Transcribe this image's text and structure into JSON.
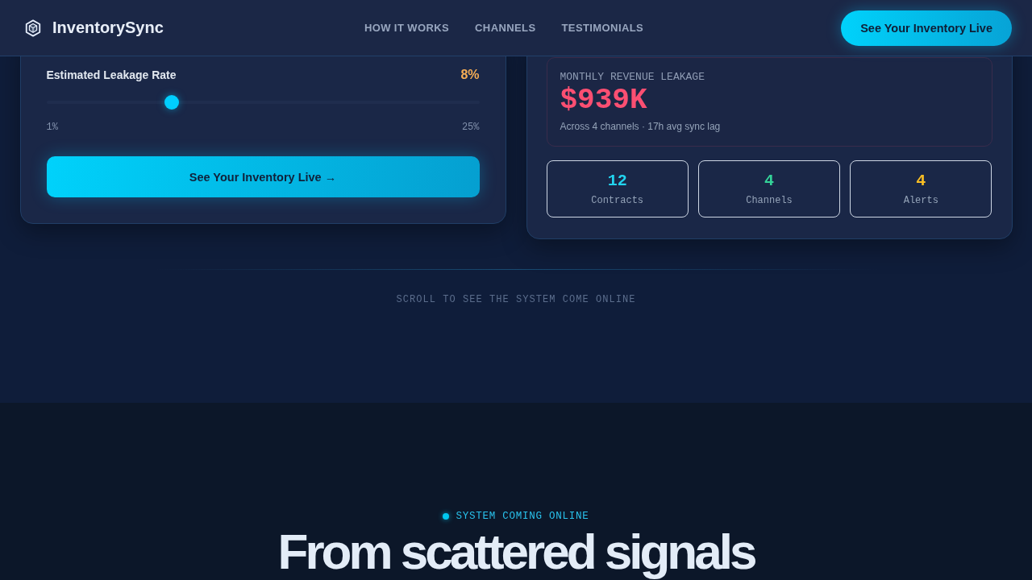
{
  "nav": {
    "brand": "InventorySync",
    "links": [
      "HOW IT WORKS",
      "CHANNELS",
      "TESTIMONIALS"
    ],
    "cta": "See Your Inventory Live"
  },
  "calculator": {
    "slider": {
      "label": "Estimated Leakage Rate",
      "reading": "8%",
      "level": 0.29,
      "min_label": "1%",
      "max_label": "25%"
    },
    "button": "See Your Inventory Live →"
  },
  "results": {
    "leakage": {
      "label": "MONTHLY REVENUE LEAKAGE",
      "value": "$939K",
      "note": "Across 4 channels · 17h avg sync lag"
    },
    "stats": [
      {
        "value": "12",
        "label": "Contracts",
        "color": "#22d3ee"
      },
      {
        "value": "4",
        "label": "Channels",
        "color": "#34d399"
      },
      {
        "value": "4",
        "label": "Alerts",
        "color": "#fbbf24"
      }
    ]
  },
  "scroll_hint": "SCROLL TO SEE THE SYSTEM COME ONLINE",
  "section": {
    "eyebrow": "SYSTEM COMING ONLINE",
    "heading": "From scattered signals"
  }
}
